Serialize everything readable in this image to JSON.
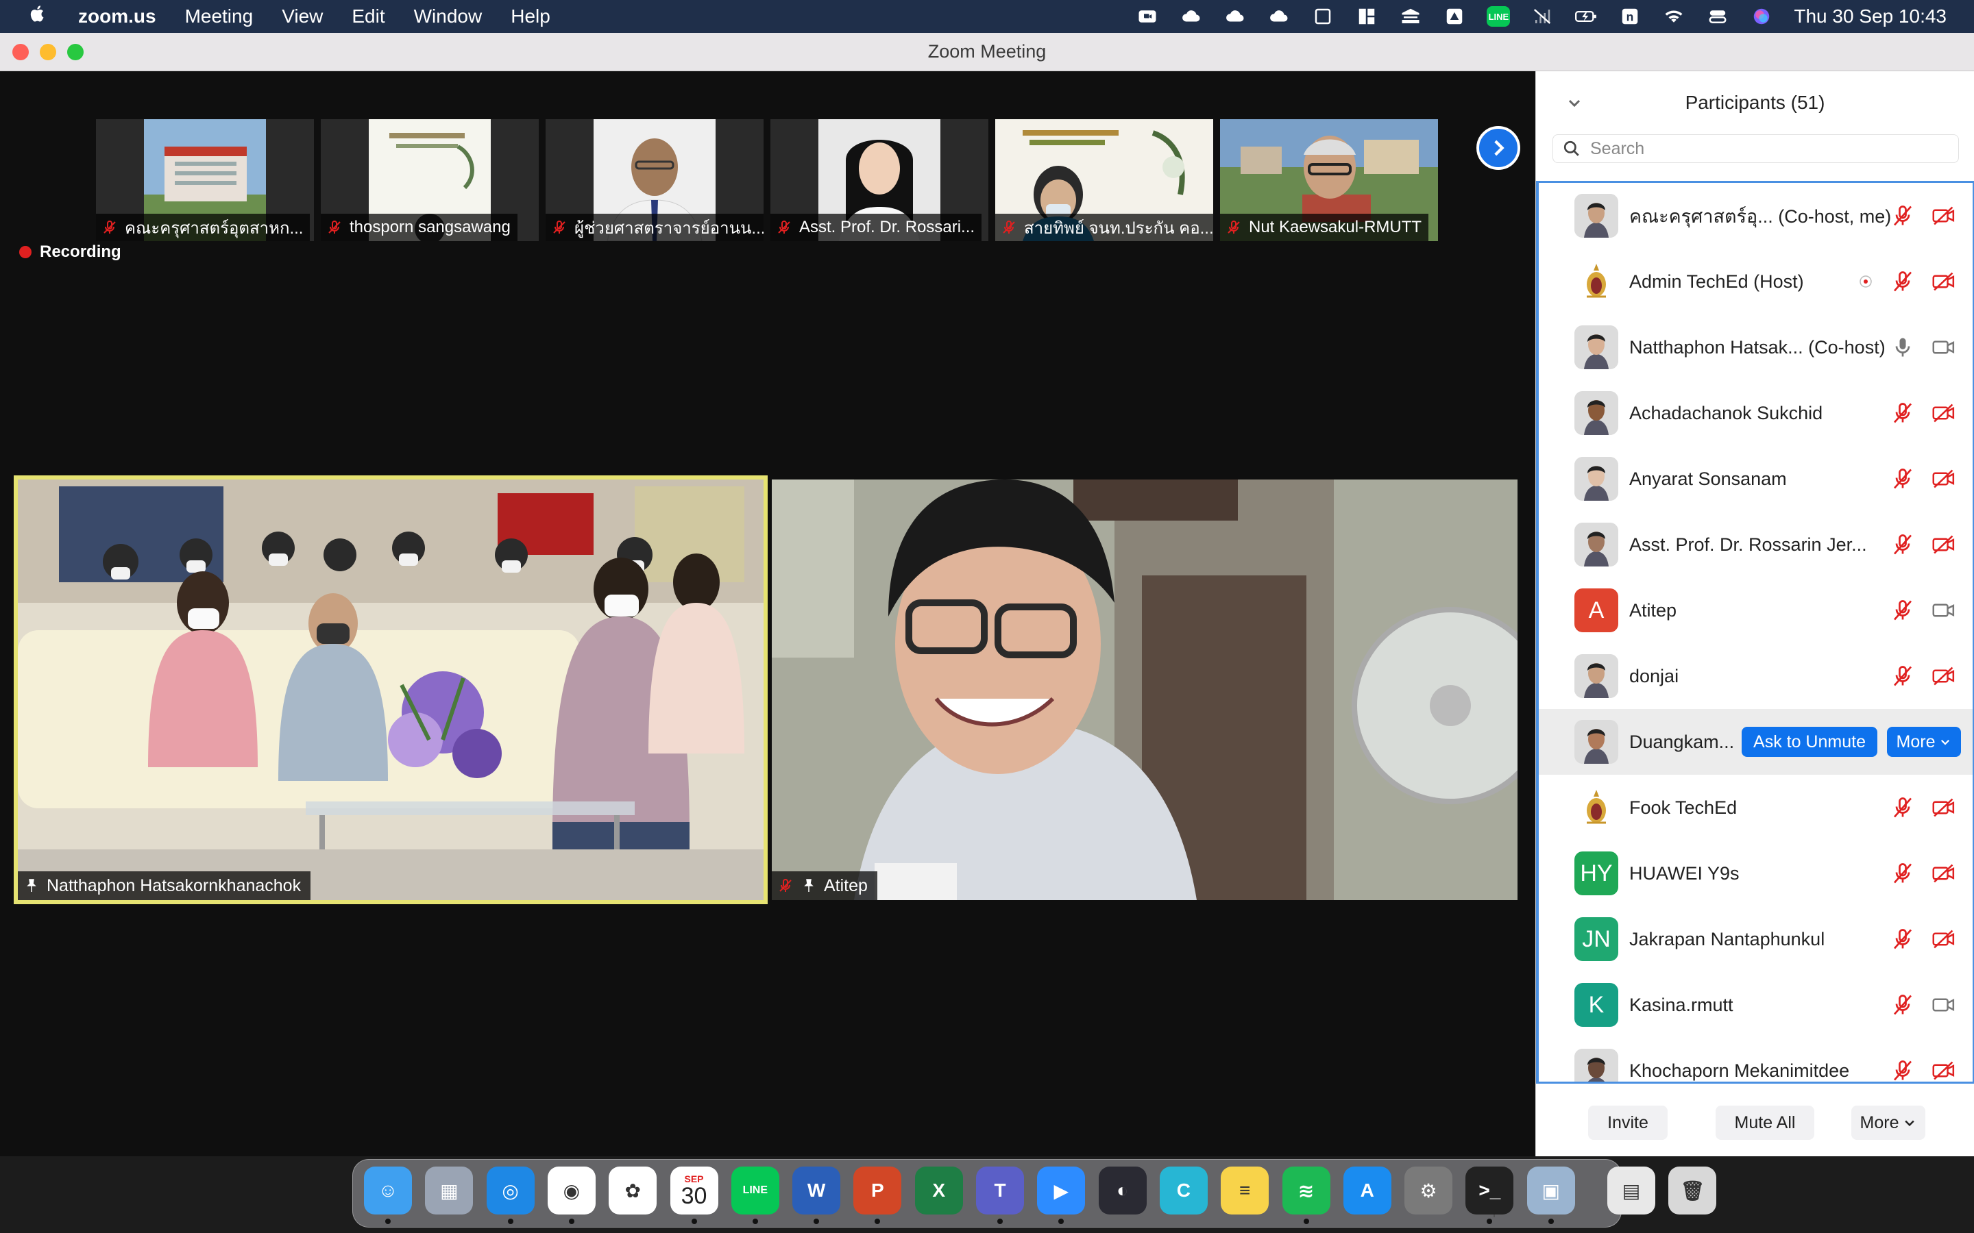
{
  "menubar": {
    "app": "zoom.us",
    "items": [
      "Meeting",
      "View",
      "Edit",
      "Window",
      "Help"
    ],
    "line_badge": "LINE",
    "clock": "Thu 30 Sep  10:43"
  },
  "window": {
    "title": "Zoom Meeting"
  },
  "recording": {
    "label": "Recording",
    "color": "#e02020"
  },
  "thumbnails": [
    {
      "name": "คณะครุศาสตร์อุตสาหก...",
      "icon": "building-photo"
    },
    {
      "name": "thosporn sangsawang",
      "icon": "poster-photo"
    },
    {
      "name": "ผู้ช่วยศาสตราจารย์อานน...",
      "icon": "portrait-photo"
    },
    {
      "name": "Asst. Prof. Dr. Rossari...",
      "icon": "portrait-photo"
    },
    {
      "name": "สายทิพย์ จนท.ประกัน คอ...",
      "icon": "poster-photo"
    },
    {
      "name": "Nut Kaewsakul-RMUTT",
      "icon": "campus-photo"
    }
  ],
  "main_videos": [
    {
      "name": "Natthaphon Hatsakornkhanachok",
      "active_speaker": true
    },
    {
      "name": "Atitep",
      "active_speaker": false
    }
  ],
  "participants_panel": {
    "title": "Participants (51)",
    "search_placeholder": "Search",
    "rows": [
      {
        "name": "คณะครุศาสตร์อุ...",
        "role": "(Co-host, me)",
        "avatar": "photo",
        "mic": "muted",
        "video": "off"
      },
      {
        "name": "Admin TechEd (Host)",
        "role": "",
        "avatar": "emblem",
        "mic": "muted",
        "video": "off",
        "recording": true
      },
      {
        "name": "Natthaphon Hatsak...",
        "role": "(Co-host)",
        "avatar": "photo",
        "mic": "on",
        "video": "on"
      },
      {
        "name": "Achadachanok Sukchid",
        "role": "",
        "avatar": "photo",
        "mic": "muted",
        "video": "off"
      },
      {
        "name": "Anyarat Sonsanam",
        "role": "",
        "avatar": "photo",
        "mic": "muted",
        "video": "off"
      },
      {
        "name": "Asst. Prof. Dr. Rossarin  Jer...",
        "role": "",
        "avatar": "photo",
        "mic": "muted",
        "video": "off"
      },
      {
        "name": "Atitep",
        "role": "",
        "avatar": "A",
        "avatar_color": "#e0442f",
        "mic": "muted",
        "video": "on"
      },
      {
        "name": "donjai",
        "role": "",
        "avatar": "photo",
        "mic": "muted",
        "video": "off"
      },
      {
        "name": "Duangkam...",
        "role": "",
        "avatar": "photo",
        "hover": true,
        "ask_label": "Ask to Unmute",
        "more_label": "More"
      },
      {
        "name": "Fook TechEd",
        "role": "",
        "avatar": "emblem",
        "mic": "muted",
        "video": "off"
      },
      {
        "name": "HUAWEI Y9s",
        "role": "",
        "avatar": "HY",
        "avatar_color": "#1fa856",
        "mic": "muted",
        "video": "off"
      },
      {
        "name": "Jakrapan Nantaphunkul",
        "role": "",
        "avatar": "JN",
        "avatar_color": "#1fa871",
        "mic": "muted",
        "video": "off"
      },
      {
        "name": "Kasina.rmutt",
        "role": "",
        "avatar": "K",
        "avatar_color": "#16a085",
        "mic": "muted",
        "video": "on"
      },
      {
        "name": "Khochaporn Mekanimitdee",
        "role": "",
        "avatar": "photo",
        "mic": "muted",
        "video": "off"
      }
    ],
    "footer": {
      "invite": "Invite",
      "mute_all": "Mute All",
      "more": "More"
    }
  },
  "dock": {
    "calendar_month": "SEP",
    "calendar_day": "30",
    "apps": [
      "finder",
      "launchpad",
      "safari",
      "chrome",
      "photos",
      "calendar",
      "line",
      "word",
      "powerpoint",
      "excel",
      "teams",
      "zoom",
      "obs",
      "canva",
      "notes",
      "spotify",
      "app-store",
      "system-preferences",
      "terminal",
      "preview",
      "documents",
      "trash"
    ]
  }
}
